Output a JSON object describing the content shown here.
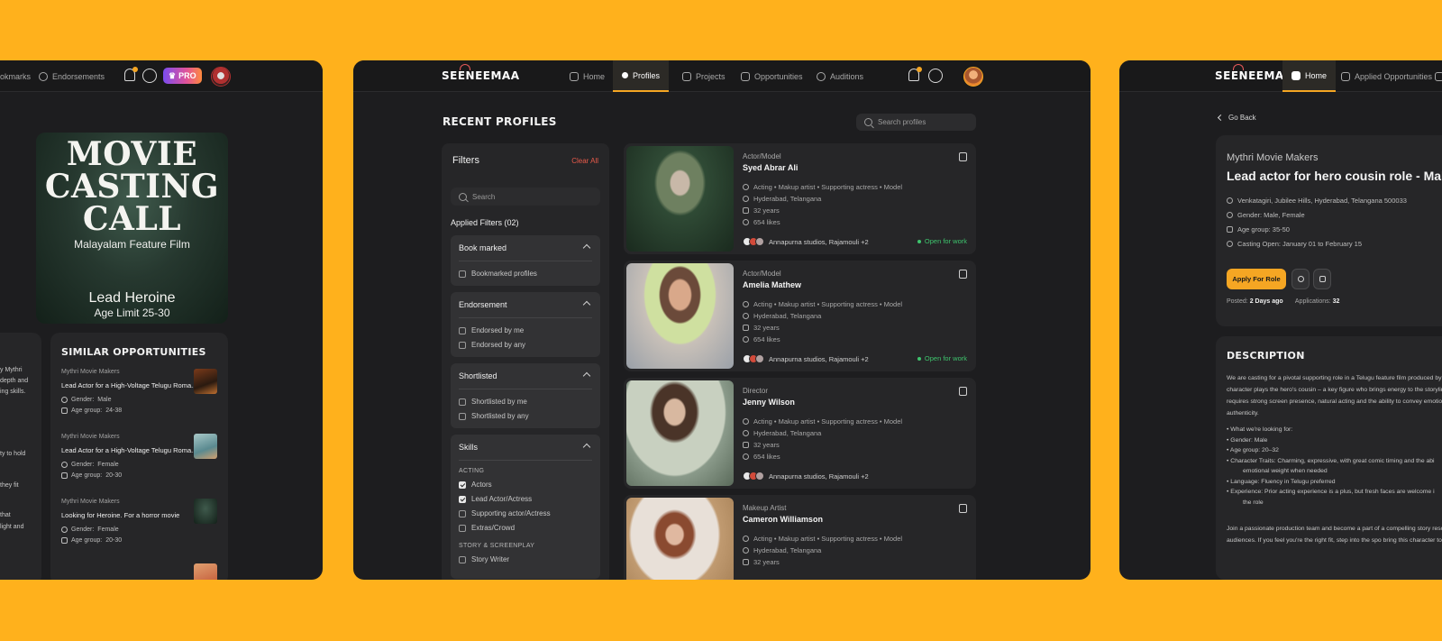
{
  "left": {
    "nav": [
      "okmarks",
      "Endorsements"
    ],
    "pro_label": "PRO",
    "poster": {
      "title_line1": "MOVIE",
      "title_line2": "CASTING",
      "title_line3": "CALL",
      "subtitle": "Malayalam Feature Film",
      "lead": "Lead Heroine",
      "age": "Age Limit 25-30"
    },
    "fragments": [
      "y Mythri",
      "depth and",
      "ing skills.",
      "ty to hold",
      "they fit",
      "that",
      "light and"
    ],
    "similar": {
      "title": "SIMILAR OPPORTUNITIES",
      "items": [
        {
          "company": "Mythri Movie Makers",
          "title": "Lead Actor for a High-Voltage Telugu Roma...",
          "gender_label": "Gender:",
          "gender": "Male",
          "age_label": "Age group:",
          "age": "24-38"
        },
        {
          "company": "Mythri Movie Makers",
          "title": "Lead Actor for a High-Voltage Telugu Roma...",
          "gender_label": "Gender:",
          "gender": "Female",
          "age_label": "Age group:",
          "age": "20-30"
        },
        {
          "company": "Mythri Movie Makers",
          "title": "Looking for Heroine. For a horror movie",
          "gender_label": "Gender:",
          "gender": "Female",
          "age_label": "Age group:",
          "age": "20-30"
        }
      ]
    }
  },
  "center": {
    "logo": "SEENEEMAA",
    "nav": [
      {
        "label": "Home"
      },
      {
        "label": "Profiles"
      },
      {
        "label": "Projects"
      },
      {
        "label": "Opportunities"
      },
      {
        "label": "Auditions"
      }
    ],
    "page_title": "RECENT PROFILES",
    "search_placeholder": "Search profiles",
    "filters": {
      "title": "Filters",
      "clear": "Clear All",
      "search_placeholder": "Search",
      "applied": "Applied Filters (02)",
      "groups": [
        {
          "title": "Book marked",
          "options": [
            "Bookmarked profiles"
          ]
        },
        {
          "title": "Endorsement",
          "options": [
            "Endorsed by me",
            "Endorsed by any"
          ]
        },
        {
          "title": "Shortlisted",
          "options": [
            "Shortlisted by me",
            "Shortlisted by any"
          ]
        },
        {
          "title": "Skills",
          "cat1": "ACTING",
          "options": [
            "Actors",
            "Lead Actor/Actress",
            "Supporting actor/Actress",
            "Extras/Crowd"
          ],
          "cat2": "STORY & SCREENPLAY",
          "options2": [
            "Story Writer"
          ]
        }
      ]
    },
    "profiles": [
      {
        "role": "Actor/Model",
        "name": "Syed Abrar Ali",
        "skills": "Acting • Makup artist • Supporting actress • Model",
        "location": "Hyderabad, Telangana",
        "age": "32 years",
        "likes": "654 likes",
        "studios": "Annapurna studios, Rajamouli +2",
        "status": "Open for work"
      },
      {
        "role": "Actor/Model",
        "name": "Amelia Mathew",
        "skills": "Acting • Makup artist • Supporting actress • Model",
        "location": "Hyderabad, Telangana",
        "age": "32 years",
        "likes": "654 likes",
        "studios": "Annapurna studios, Rajamouli +2",
        "status": "Open for work"
      },
      {
        "role": "Director",
        "name": "Jenny Wilson",
        "skills": "Acting • Makup artist • Supporting actress • Model",
        "location": "Hyderabad, Telangana",
        "age": "32 years",
        "likes": "654 likes",
        "studios": "Annapurna studios, Rajamouli +2",
        "status": ""
      },
      {
        "role": "Makeup Artist",
        "name": "Cameron Williamson",
        "skills": "Acting • Makup artist • Supporting actress • Model",
        "location": "Hyderabad, Telangana",
        "age": "32 years",
        "likes": "",
        "studios": "",
        "status": ""
      }
    ]
  },
  "right": {
    "logo": "SEENEEMAA",
    "nav": [
      {
        "label": "Home"
      },
      {
        "label": "Applied Opportunities"
      },
      {
        "label": "Bo"
      }
    ],
    "go_back": "Go Back",
    "detail": {
      "company": "Mythri Movie Makers",
      "title": "Lead actor for hero cousin role - Male",
      "location": "Venkatagiri, Jubilee Hills, Hyderabad, Telangana 500033",
      "gender": "Gender: Male, Female",
      "age": "Age group: 35-50",
      "casting": "Casting Open: January 01 to February 15",
      "apply": "Apply For Role",
      "posted_label": "Posted:",
      "posted": "2 Days ago",
      "applications_label": "Applications:",
      "applications": "32"
    },
    "description": {
      "title": "DESCRIPTION",
      "para1": "We are casting for a pivotal supporting role in a Telugu feature film produced by Movie Makers. This character plays the hero's cousin – a key figure who brings energy to the storyline. The role requires strong screen presence, natural acting and the ability to convey emotional range with authenticity.",
      "bullets": [
        "What we're looking for:",
        "Gender: Male",
        "Age group: 20–32",
        "Character Traits: Charming, expressive, with great comic timing and the abi",
        "emotional weight when needed",
        "Language: Fluency in Telugu preferred",
        "Experience: Prior acting experience is a plus, but fresh faces are welcome i",
        "the role"
      ],
      "para2": "Join a passionate production team and become a part of a compelling story resonates with wide audiences. If you feel you're the right fit, step into the spo bring this character to life."
    }
  }
}
